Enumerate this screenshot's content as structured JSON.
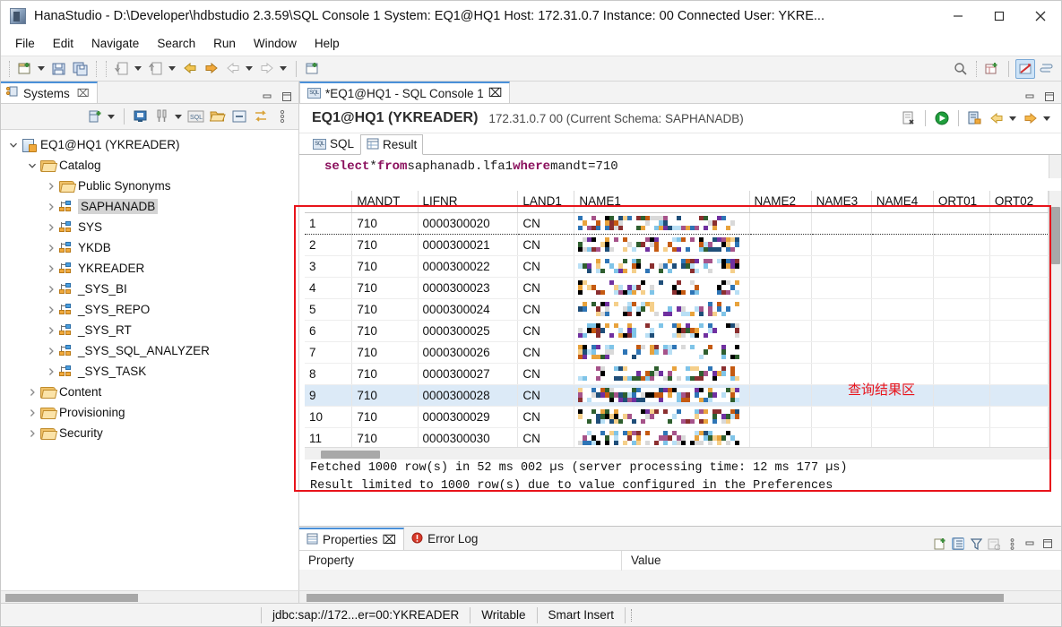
{
  "window": {
    "title": "HanaStudio - D:\\Developer\\hdbstudio 2.3.59\\SQL Console 1 System: EQ1@HQ1 Host: 172.31.0.7 Instance: 00 Connected User: YKRE...",
    "app_icon": "hana-studio-icon",
    "minimize": "—",
    "maximize": "□",
    "close": "✕"
  },
  "menu": {
    "items": [
      "File",
      "Edit",
      "Navigate",
      "Search",
      "Run",
      "Window",
      "Help"
    ]
  },
  "toolbar": {
    "left_icons": [
      "new-wizard-icon",
      "new-dropdown-caret",
      "save-icon",
      "save-all-icon",
      "import-icon",
      "import-dropdown-caret",
      "export-icon",
      "export-dropdown-caret",
      "back-yellow-icon",
      "forward-yellow-icon",
      "back-grey-icon",
      "back-grey-caret",
      "forward-grey-icon",
      "forward-grey-caret",
      "open-sql-console-icon"
    ],
    "right_icons": [
      "search-icon",
      "new-perspective-icon",
      "hana-perspective-icon",
      "other-perspective-icon"
    ]
  },
  "systems_view": {
    "tab_label": "Systems",
    "tab_icon": "systems-icon",
    "close_icon": "⌧",
    "minimize_icon": "minimize-view-icon",
    "maximize_icon": "maximize-view-icon",
    "toolbar_icons": [
      "add-system-icon",
      "add-system-caret",
      "open-admin-console-icon",
      "system-monitor-icon",
      "system-monitor-caret",
      "sql-console-icon",
      "open-folder-icon",
      "collapse-all-icon",
      "link-icon",
      "view-menu-icon"
    ],
    "tree": [
      {
        "label": "EQ1@HQ1 (YKREADER)",
        "depth": 0,
        "twisty": "down",
        "icon": "system-icon",
        "selected": false
      },
      {
        "label": "Catalog",
        "depth": 1,
        "twisty": "down",
        "icon": "folder-icon",
        "selected": false
      },
      {
        "label": "Public Synonyms",
        "depth": 2,
        "twisty": "right",
        "icon": "folder-icon",
        "selected": false
      },
      {
        "label": "SAPHANADB",
        "depth": 2,
        "twisty": "right",
        "icon": "schema-icon",
        "selected": true
      },
      {
        "label": "SYS",
        "depth": 2,
        "twisty": "right",
        "icon": "schema-icon",
        "selected": false
      },
      {
        "label": "YKDB",
        "depth": 2,
        "twisty": "right",
        "icon": "schema-icon",
        "selected": false
      },
      {
        "label": "YKREADER",
        "depth": 2,
        "twisty": "right",
        "icon": "schema-icon",
        "selected": false
      },
      {
        "label": "_SYS_BI",
        "depth": 2,
        "twisty": "right",
        "icon": "schema-icon",
        "selected": false
      },
      {
        "label": "_SYS_REPO",
        "depth": 2,
        "twisty": "right",
        "icon": "schema-icon",
        "selected": false
      },
      {
        "label": "_SYS_RT",
        "depth": 2,
        "twisty": "right",
        "icon": "schema-icon",
        "selected": false
      },
      {
        "label": "_SYS_SQL_ANALYZER",
        "depth": 2,
        "twisty": "right",
        "icon": "schema-icon",
        "selected": false
      },
      {
        "label": "_SYS_TASK",
        "depth": 2,
        "twisty": "right",
        "icon": "schema-icon",
        "selected": false
      },
      {
        "label": "Content",
        "depth": 1,
        "twisty": "right",
        "icon": "folder-icon",
        "selected": false
      },
      {
        "label": "Provisioning",
        "depth": 1,
        "twisty": "right",
        "icon": "folder-icon",
        "selected": false
      },
      {
        "label": "Security",
        "depth": 1,
        "twisty": "right",
        "icon": "folder-icon",
        "selected": false
      }
    ]
  },
  "editor": {
    "tab_label": "*EQ1@HQ1 - SQL Console 1",
    "tab_icon": "sql-console-icon",
    "tab_close": "⌧",
    "minimize_icon": "minimize-view-icon",
    "maximize_icon": "maximize-view-icon",
    "console_title": "EQ1@HQ1 (YKREADER)",
    "console_subtitle": "172.31.0.7 00 (Current Schema: SAPHANADB)",
    "header_icons": [
      "clear-sql-icon",
      "execute-icon",
      "save-as-icon",
      "back-arrow-icon",
      "back-arrow-caret",
      "forward-arrow-icon",
      "forward-arrow-caret"
    ],
    "inner_tabs": [
      {
        "label": "SQL",
        "icon": "sql-icon",
        "active": false
      },
      {
        "label": "Result",
        "icon": "result-grid-icon",
        "active": true
      }
    ],
    "sql_statement": {
      "tokens": [
        {
          "text": "select ",
          "type": "keyword"
        },
        {
          "text": "* ",
          "type": "plain"
        },
        {
          "text": "from ",
          "type": "keyword"
        },
        {
          "text": "saphanadb.lfa1 ",
          "type": "plain"
        },
        {
          "text": "where ",
          "type": "keyword"
        },
        {
          "text": "mandt=710",
          "type": "plain"
        }
      ],
      "full_text": "select * from saphanadb.lfa1 where mandt=710"
    }
  },
  "result_grid": {
    "columns": [
      "",
      "MANDT",
      "LIFNR",
      "LAND1",
      "NAME1",
      "NAME2",
      "NAME3",
      "NAME4",
      "ORT01",
      "ORT02"
    ],
    "rows": [
      {
        "n": "1",
        "MANDT": "710",
        "LIFNR": "0000300020",
        "LAND1": "CN",
        "NAME1": "",
        "NAME2": "",
        "NAME3": "",
        "NAME4": "",
        "ORT01": "",
        "ORT02": "",
        "selected": false
      },
      {
        "n": "2",
        "MANDT": "710",
        "LIFNR": "0000300021",
        "LAND1": "CN",
        "NAME1": "",
        "NAME2": "",
        "NAME3": "",
        "NAME4": "",
        "ORT01": "",
        "ORT02": "",
        "selected": false
      },
      {
        "n": "3",
        "MANDT": "710",
        "LIFNR": "0000300022",
        "LAND1": "CN",
        "NAME1": "",
        "NAME2": "",
        "NAME3": "",
        "NAME4": "",
        "ORT01": "",
        "ORT02": "",
        "selected": false
      },
      {
        "n": "4",
        "MANDT": "710",
        "LIFNR": "0000300023",
        "LAND1": "CN",
        "NAME1": "",
        "NAME2": "",
        "NAME3": "",
        "NAME4": "",
        "ORT01": "",
        "ORT02": "",
        "selected": false
      },
      {
        "n": "5",
        "MANDT": "710",
        "LIFNR": "0000300024",
        "LAND1": "CN",
        "NAME1": "",
        "NAME2": "",
        "NAME3": "",
        "NAME4": "",
        "ORT01": "",
        "ORT02": "",
        "selected": false
      },
      {
        "n": "6",
        "MANDT": "710",
        "LIFNR": "0000300025",
        "LAND1": "CN",
        "NAME1": "",
        "NAME2": "",
        "NAME3": "",
        "NAME4": "",
        "ORT01": "",
        "ORT02": "",
        "selected": false
      },
      {
        "n": "7",
        "MANDT": "710",
        "LIFNR": "0000300026",
        "LAND1": "CN",
        "NAME1": "",
        "NAME2": "",
        "NAME3": "",
        "NAME4": "",
        "ORT01": "",
        "ORT02": "",
        "selected": false
      },
      {
        "n": "8",
        "MANDT": "710",
        "LIFNR": "0000300027",
        "LAND1": "CN",
        "NAME1": "",
        "NAME2": "",
        "NAME3": "",
        "NAME4": "",
        "ORT01": "",
        "ORT02": "",
        "selected": false
      },
      {
        "n": "9",
        "MANDT": "710",
        "LIFNR": "0000300028",
        "LAND1": "CN",
        "NAME1": "",
        "NAME2": "",
        "NAME3": "",
        "NAME4": "",
        "ORT01": "",
        "ORT02": "",
        "selected": true
      },
      {
        "n": "10",
        "MANDT": "710",
        "LIFNR": "0000300029",
        "LAND1": "CN",
        "NAME1": "",
        "NAME2": "",
        "NAME3": "",
        "NAME4": "",
        "ORT01": "",
        "ORT02": "",
        "selected": false
      },
      {
        "n": "11",
        "MANDT": "710",
        "LIFNR": "0000300030",
        "LAND1": "CN",
        "NAME1": "",
        "NAME2": "",
        "NAME3": "",
        "NAME4": "",
        "ORT01": "",
        "ORT02": "",
        "selected": false
      }
    ],
    "note_text": "NAME1 column values are pixelated / redacted in the screenshot"
  },
  "annotations": {
    "result_area_label": "查询结果区",
    "result_area_color": "#e8131b",
    "box_color": "#e8131b"
  },
  "messages": {
    "line1": "Fetched 1000 row(s) in 52 ms 002 µs (server processing time: 12 ms 177 µs)",
    "line2": "Result limited to 1000 row(s) due to value configured in the Preferences"
  },
  "bottom_view": {
    "tabs": [
      {
        "label": "Properties",
        "icon": "properties-icon",
        "active": true,
        "close": "⌧"
      },
      {
        "label": "Error Log",
        "icon": "error-log-icon",
        "active": false
      }
    ],
    "toolbar_icons": [
      "new-properties-icon",
      "show-categories-icon",
      "filter-icon",
      "restore-default-icon",
      "view-menu-icon",
      "minimize-view-icon",
      "maximize-view-icon"
    ],
    "columns": [
      "Property",
      "Value"
    ]
  },
  "statusbar": {
    "connection": "jdbc:sap://172...er=00:YKREADER",
    "writable": "Writable",
    "insert_mode": "Smart Insert"
  }
}
